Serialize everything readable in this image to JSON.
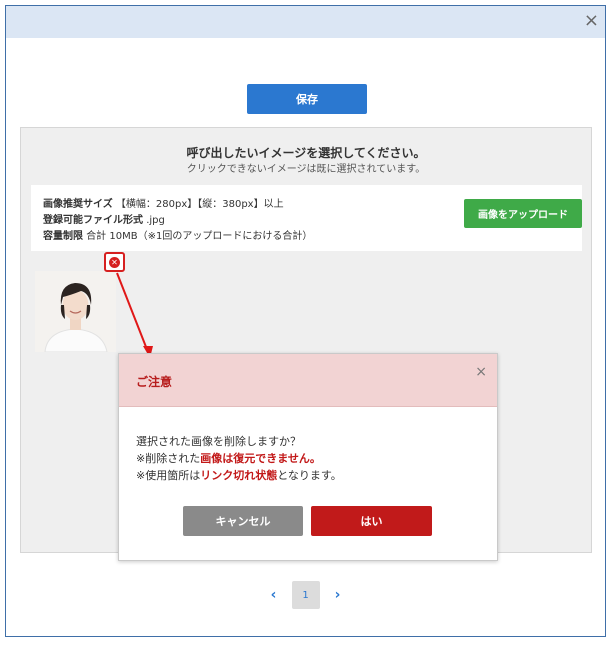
{
  "window": {
    "close_glyph": "×"
  },
  "toolbar": {
    "save_label": "保存"
  },
  "panel": {
    "title": "呼び出したいイメージを選択してください。",
    "subtitle": "クリックできないイメージは既に選択されています。",
    "info": {
      "size_label": "画像推奨サイズ",
      "size_value": "【横幅：280px】【縦：380px】以上",
      "format_label": "登録可能ファイル形式",
      "format_value": ".jpg",
      "capacity_label": "容量制限",
      "capacity_value": "合計 10MB（※1回のアップロードにおける合計）"
    },
    "upload_label": "画像をアップロード"
  },
  "image_item": {
    "delete_icon": "delete-circle-icon"
  },
  "dialog": {
    "title": "ご注意",
    "close_glyph": "×",
    "line1": "選択された画像を削除しますか？",
    "line2_pre": "※削除された",
    "line2_red": "画像は復元できません。",
    "line3_pre": "※使用箇所は",
    "line3_red": "リンク切れ状態",
    "line3_post": "となります。",
    "cancel_label": "キャンセル",
    "ok_label": "はい"
  },
  "pagination": {
    "prev": "‹",
    "current": "1",
    "next": "›"
  },
  "colors": {
    "accent": "#2b78d0",
    "upload": "#3faa48",
    "danger": "#c11a1a",
    "titlebar": "#dbe6f4"
  }
}
